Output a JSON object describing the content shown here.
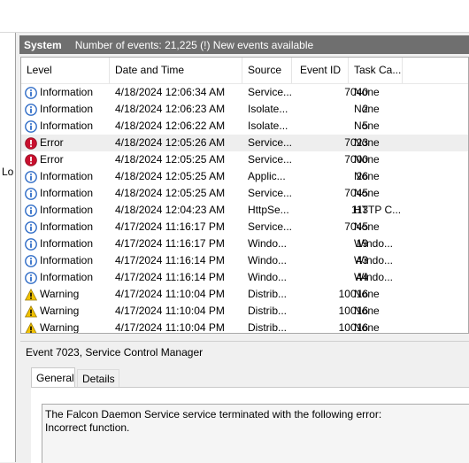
{
  "left_pane": {
    "label": "Lo"
  },
  "header": {
    "title": "System",
    "count": "Number of events: 21,225 (!) New events available"
  },
  "columns": {
    "level": "Level",
    "date": "Date and Time",
    "source": "Source",
    "event_id": "Event ID",
    "task": "Task Ca..."
  },
  "rows": [
    {
      "level": "Information",
      "icon": "info-icon",
      "date": "4/18/2024 12:06:34 AM",
      "source": "Service...",
      "event_id": "7040",
      "task": "None"
    },
    {
      "level": "Information",
      "icon": "info-icon",
      "date": "4/18/2024 12:06:23 AM",
      "source": "Isolate...",
      "event_id": "2",
      "task": "None"
    },
    {
      "level": "Information",
      "icon": "info-icon",
      "date": "4/18/2024 12:06:22 AM",
      "source": "Isolate...",
      "event_id": "5",
      "task": "None"
    },
    {
      "level": "Error",
      "icon": "error-icon",
      "date": "4/18/2024 12:05:26 AM",
      "source": "Service...",
      "event_id": "7023",
      "task": "None",
      "selected": true
    },
    {
      "level": "Error",
      "icon": "error-icon",
      "date": "4/18/2024 12:05:25 AM",
      "source": "Service...",
      "event_id": "7000",
      "task": "None"
    },
    {
      "level": "Information",
      "icon": "info-icon",
      "date": "4/18/2024 12:05:25 AM",
      "source": "Applic...",
      "event_id": "26",
      "task": "None"
    },
    {
      "level": "Information",
      "icon": "info-icon",
      "date": "4/18/2024 12:05:25 AM",
      "source": "Service...",
      "event_id": "7045",
      "task": "None"
    },
    {
      "level": "Information",
      "icon": "info-icon",
      "date": "4/18/2024 12:04:23 AM",
      "source": "HttpSe...",
      "event_id": "113",
      "task": "HTTP C..."
    },
    {
      "level": "Information",
      "icon": "info-icon",
      "date": "4/17/2024 11:16:17 PM",
      "source": "Service...",
      "event_id": "7045",
      "task": "None"
    },
    {
      "level": "Information",
      "icon": "info-icon",
      "date": "4/17/2024 11:16:17 PM",
      "source": "Windo...",
      "event_id": "19",
      "task": "Windo..."
    },
    {
      "level": "Information",
      "icon": "info-icon",
      "date": "4/17/2024 11:16:14 PM",
      "source": "Windo...",
      "event_id": "43",
      "task": "Windo..."
    },
    {
      "level": "Information",
      "icon": "info-icon",
      "date": "4/17/2024 11:16:14 PM",
      "source": "Windo...",
      "event_id": "44",
      "task": "Windo..."
    },
    {
      "level": "Warning",
      "icon": "warning-icon",
      "date": "4/17/2024 11:10:04 PM",
      "source": "Distrib...",
      "event_id": "10016",
      "task": "None"
    },
    {
      "level": "Warning",
      "icon": "warning-icon",
      "date": "4/17/2024 11:10:04 PM",
      "source": "Distrib...",
      "event_id": "10016",
      "task": "None"
    },
    {
      "level": "Warning",
      "icon": "warning-icon",
      "date": "4/17/2024 11:10:04 PM",
      "source": "Distrib...",
      "event_id": "10016",
      "task": "None"
    }
  ],
  "detail": {
    "title": "Event 7023, Service Control Manager",
    "tabs": {
      "general": "General",
      "details": "Details"
    },
    "line1": "The Falcon Daemon Service service terminated with the following error:",
    "line2": "Incorrect function."
  },
  "colors": {
    "header_bg": "#6f6f6f",
    "info": "#2e6bc6",
    "error": "#c8102e",
    "warning": "#f2c200",
    "selected_row": "#eeeeee"
  }
}
